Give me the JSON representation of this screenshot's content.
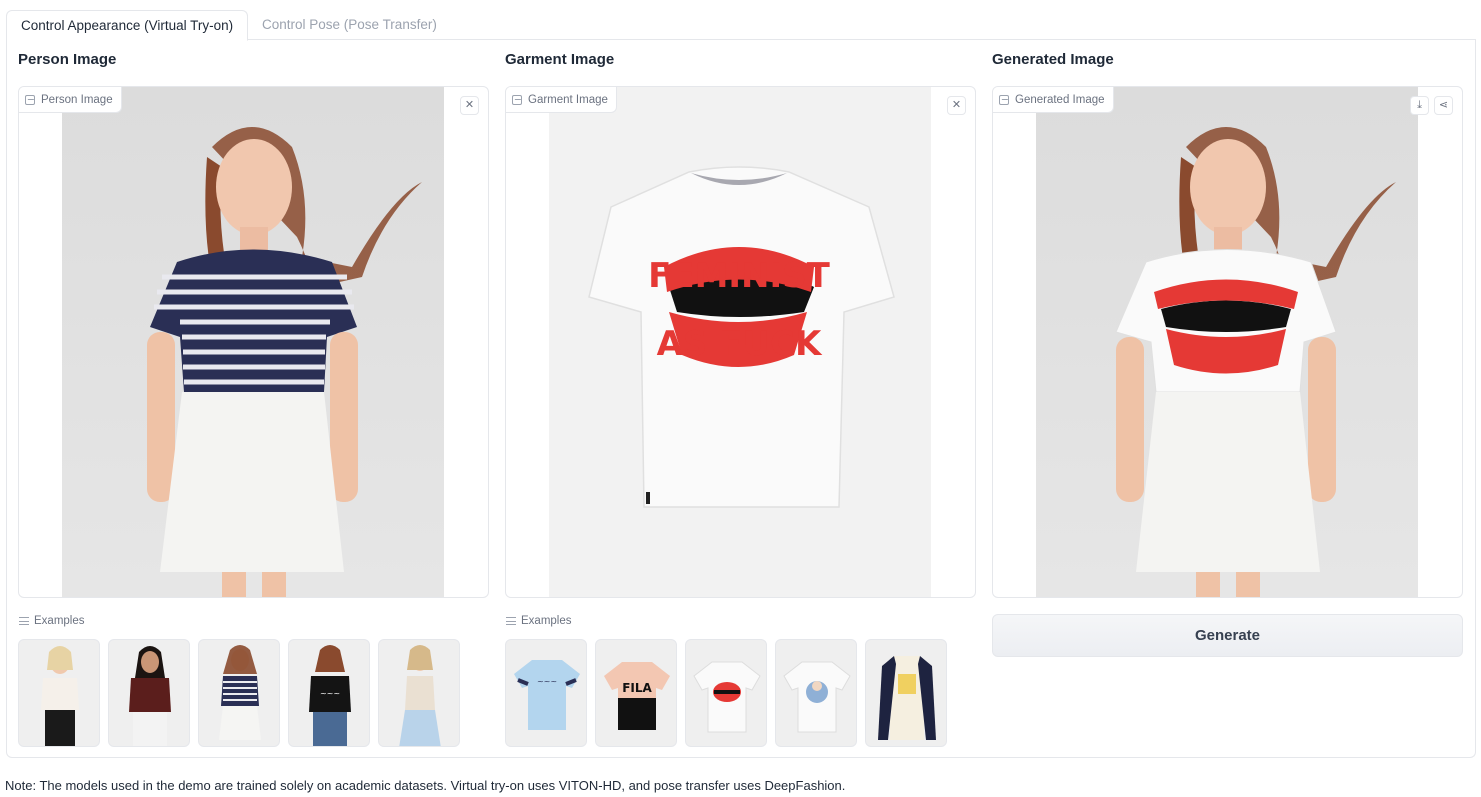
{
  "tabs": [
    {
      "label": "Control Appearance (Virtual Try-on)",
      "active": true
    },
    {
      "label": "Control Pose (Pose Transfer)",
      "active": false
    }
  ],
  "columns": {
    "person": {
      "title": "Person Image",
      "image_label": "Person Image"
    },
    "garment": {
      "title": "Garment Image",
      "image_label": "Garment Image"
    },
    "generated": {
      "title": "Generated Image",
      "image_label": "Generated Image"
    }
  },
  "examples_label": "Examples",
  "person_examples": [
    "white-tee-black-pants",
    "maroon-tee-white-jeans",
    "striped-tee-white-skirt",
    "black-graphic-tee-jeans",
    "cream-tank-blue-skirt"
  ],
  "garment_examples": [
    "light-blue-tee",
    "peach-black-colorblock-tee",
    "white-lips-graphic-tee",
    "white-anime-graphic-tee",
    "navy-raglan-long-sleeve"
  ],
  "garment_print": {
    "line1": "FEMINIST",
    "line2": "AS FUCK"
  },
  "generate_label": "Generate",
  "note": "Note: The models used in the demo are trained solely on academic datasets. Virtual try-on uses VITON-HD, and pose transfer uses DeepFashion.",
  "colors": {
    "accent_red": "#e53935",
    "navy": "#2a2f55",
    "border": "#e5e7eb"
  }
}
